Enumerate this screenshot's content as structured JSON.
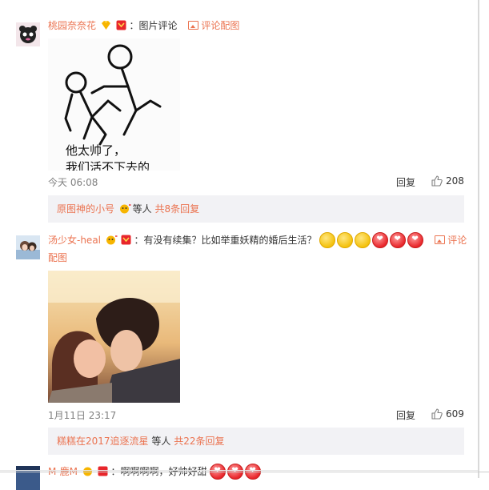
{
  "comments": [
    {
      "username": "桃园奈奈花",
      "separator": "：",
      "text": "图片评论",
      "pic_link": "评论配图",
      "image_caption_lines": [
        "他太帅了，",
        "我们活不下去的"
      ],
      "time": "今天 06:08",
      "reply_label": "回复",
      "likes": "208",
      "thread": {
        "first_user": "原图神的小号",
        "others_text": "等人",
        "total_link": "共8条回复"
      }
    },
    {
      "username": "汤少女-heal",
      "separator": "：",
      "text": "有没有续集？比如举重妖精的婚后生活？",
      "emojis": [
        "face",
        "face",
        "face",
        "heart",
        "heart",
        "heart"
      ],
      "pic_link_part1": "评论",
      "pic_link_part2": "配图",
      "time": "1月11日 23:17",
      "reply_label": "回复",
      "likes": "609",
      "thread": {
        "first_user": "糕糕在2017追逐流星",
        "others_text": "等人",
        "total_link": "共22条回复"
      }
    },
    {
      "username": "M-鹿M",
      "text": "：啊啊啊啊，好帅好甜"
    }
  ],
  "colors": {
    "accent": "#eb7350",
    "reply_box_bg": "#f2f2f5",
    "text": "#333333",
    "meta": "#808080"
  },
  "icons": [
    "user-avatar",
    "vip-badge",
    "member-badge",
    "picture-icon",
    "like-icon",
    "emoji-face",
    "emoji-heart"
  ]
}
